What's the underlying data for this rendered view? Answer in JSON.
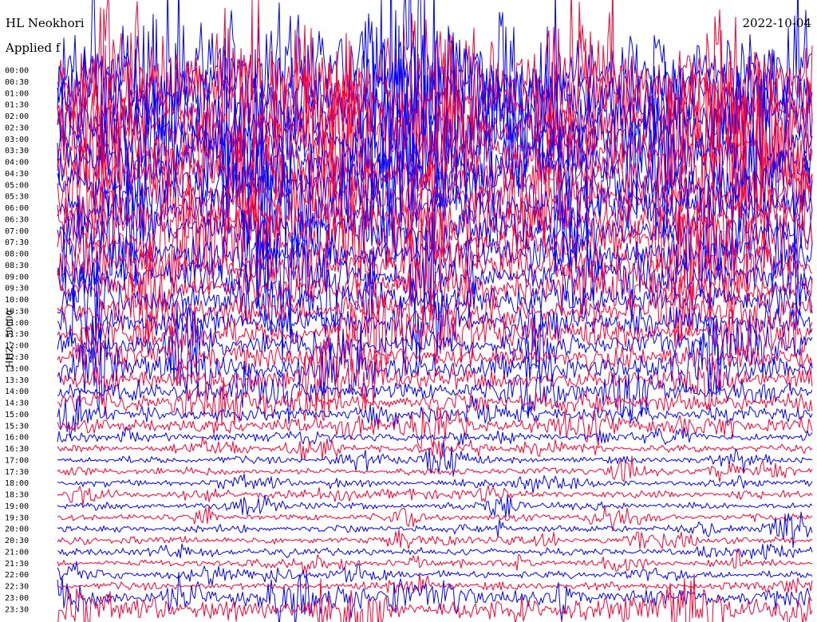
{
  "header": {
    "station": "HL Neokhori",
    "date": "2022-10-04",
    "filter": "Applied f"
  },
  "chart_data": {
    "type": "line",
    "ylabel": "HHZ - 50000",
    "tick_labels": [
      "00:00",
      "00:30",
      "01:00",
      "01:30",
      "02:00",
      "02:30",
      "03:00",
      "03:30",
      "04:00",
      "04:30",
      "05:00",
      "05:30",
      "06:00",
      "06:30",
      "07:00",
      "07:30",
      "08:00",
      "08:30",
      "09:00",
      "09:30",
      "10:00",
      "10:30",
      "11:00",
      "11:30",
      "12:00",
      "12:30",
      "13:00",
      "13:30",
      "14:00",
      "14:30",
      "15:00",
      "15:30",
      "16:00",
      "16:30",
      "17:00",
      "17:30",
      "18:00",
      "18:30",
      "19:00",
      "19:30",
      "20:00",
      "20:30",
      "21:00",
      "21:30",
      "22:00",
      "22:30",
      "23:00",
      "23:30"
    ],
    "trace_colors": [
      "#ff0033",
      "#0000ff"
    ],
    "grid": false
  }
}
